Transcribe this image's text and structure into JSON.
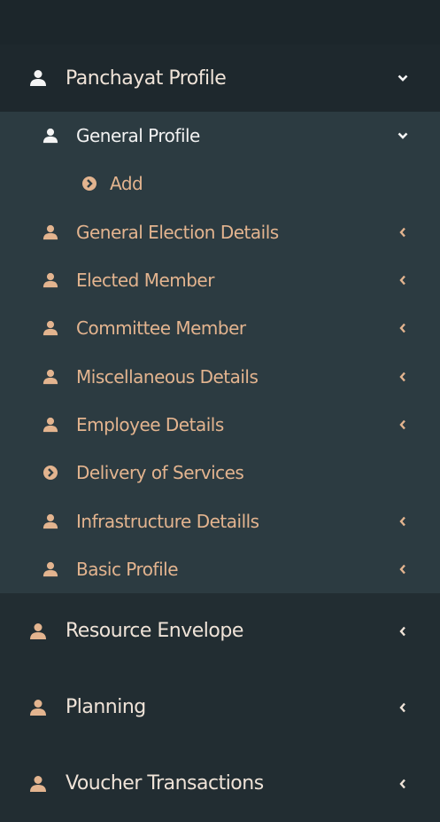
{
  "colors": {
    "sidebar_bg": "#222d32",
    "submenu_bg": "#2c3b41",
    "accent": "#e3b48f",
    "text_white": "#efe3d8"
  },
  "menu": {
    "panchayat_profile": {
      "label": "Panchayat Profile",
      "icon": "user-icon",
      "expanded": true
    },
    "general_profile": {
      "label": "General Profile",
      "icon": "user-icon",
      "expanded": true
    },
    "add": {
      "label": "Add",
      "icon": "circle-chevron-right-icon"
    },
    "submenu_items": [
      {
        "label": "General Election Details",
        "icon": "user-icon",
        "has_children": true
      },
      {
        "label": "Elected Member",
        "icon": "user-icon",
        "has_children": true
      },
      {
        "label": "Committee Member",
        "icon": "user-icon",
        "has_children": true
      },
      {
        "label": "Miscellaneous Details",
        "icon": "user-icon",
        "has_children": true
      },
      {
        "label": "Employee Details",
        "icon": "user-icon",
        "has_children": true
      },
      {
        "label": "Delivery of Services",
        "icon": "circle-chevron-right-icon",
        "has_children": false
      },
      {
        "label": "Infrastructure Detaills",
        "icon": "user-icon",
        "has_children": true
      },
      {
        "label": "Basic Profile",
        "icon": "user-icon",
        "has_children": true
      }
    ],
    "other_items": [
      {
        "label": "Resource Envelope",
        "icon": "user-icon",
        "has_children": true
      },
      {
        "label": "Planning",
        "icon": "user-icon",
        "has_children": true
      },
      {
        "label": "Voucher Transactions",
        "icon": "user-icon",
        "has_children": true
      }
    ]
  }
}
